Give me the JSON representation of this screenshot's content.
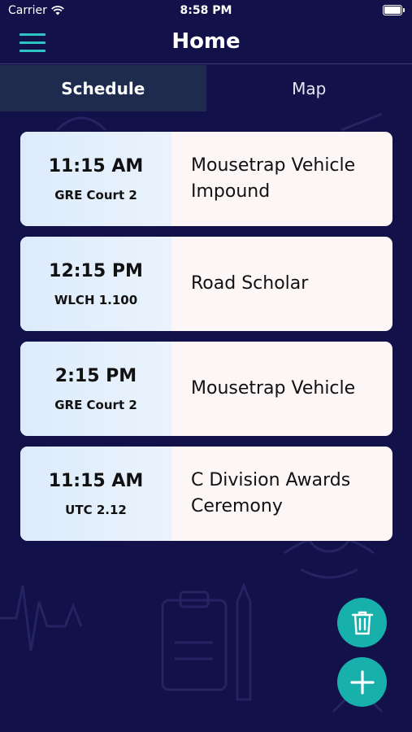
{
  "status": {
    "carrier": "Carrier",
    "time": "8:58 PM"
  },
  "nav": {
    "title": "Home"
  },
  "tabs": [
    {
      "label": "Schedule",
      "active": true
    },
    {
      "label": "Map",
      "active": false
    }
  ],
  "events": [
    {
      "time": "11:15 AM",
      "location": "GRE Court 2",
      "name": "Mousetrap Vehicle Impound"
    },
    {
      "time": "12:15 PM",
      "location": "WLCH 1.100",
      "name": "Road Scholar"
    },
    {
      "time": "2:15 PM",
      "location": "GRE Court 2",
      "name": "Mousetrap Vehicle"
    },
    {
      "time": "11:15 AM",
      "location": "UTC 2.12",
      "name": "C Division Awards Ceremony"
    }
  ],
  "colors": {
    "background": "#13114a",
    "accent": "#18b0ab",
    "menu": "#2ec4c4",
    "active_tab": "#1e2a4e"
  },
  "icons": {
    "menu": "hamburger-menu-icon",
    "delete": "trash-icon",
    "add": "plus-icon",
    "wifi": "wifi-icon",
    "battery": "battery-icon"
  }
}
